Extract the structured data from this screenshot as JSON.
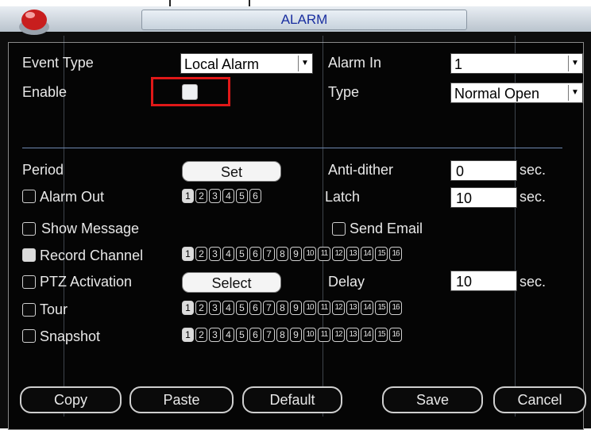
{
  "window": {
    "title": "ALARM"
  },
  "labels": {
    "event_type": "Event Type",
    "enable": "Enable",
    "alarm_in": "Alarm In",
    "type": "Type",
    "period": "Period",
    "anti_dither": "Anti-dither",
    "alarm_out": "Alarm Out",
    "latch": "Latch",
    "show_message": "Show Message",
    "send_email": "Send Email",
    "record_channel": "Record Channel",
    "ptz_activation": "PTZ Activation",
    "delay": "Delay",
    "tour": "Tour",
    "snapshot": "Snapshot",
    "sec1": "sec.",
    "sec2": "sec.",
    "sec3": "sec."
  },
  "fields": {
    "event_type": "Local Alarm",
    "alarm_in": "1",
    "type": "Normal Open",
    "anti_dither": "0",
    "latch": "10",
    "delay": "10"
  },
  "buttons": {
    "set": "Set",
    "select": "Select",
    "copy": "Copy",
    "paste": "Paste",
    "default": "Default",
    "save": "Save",
    "cancel": "Cancel"
  },
  "alarm_out_channels": [
    "1",
    "2",
    "3",
    "4",
    "5",
    "6"
  ],
  "channels16": [
    "1",
    "2",
    "3",
    "4",
    "5",
    "6",
    "7",
    "8",
    "9",
    "10",
    "11",
    "12",
    "13",
    "14",
    "15",
    "16"
  ],
  "colors": {
    "title_text": "#1a2fa0",
    "highlight": "#e01818",
    "background": "#050505"
  }
}
